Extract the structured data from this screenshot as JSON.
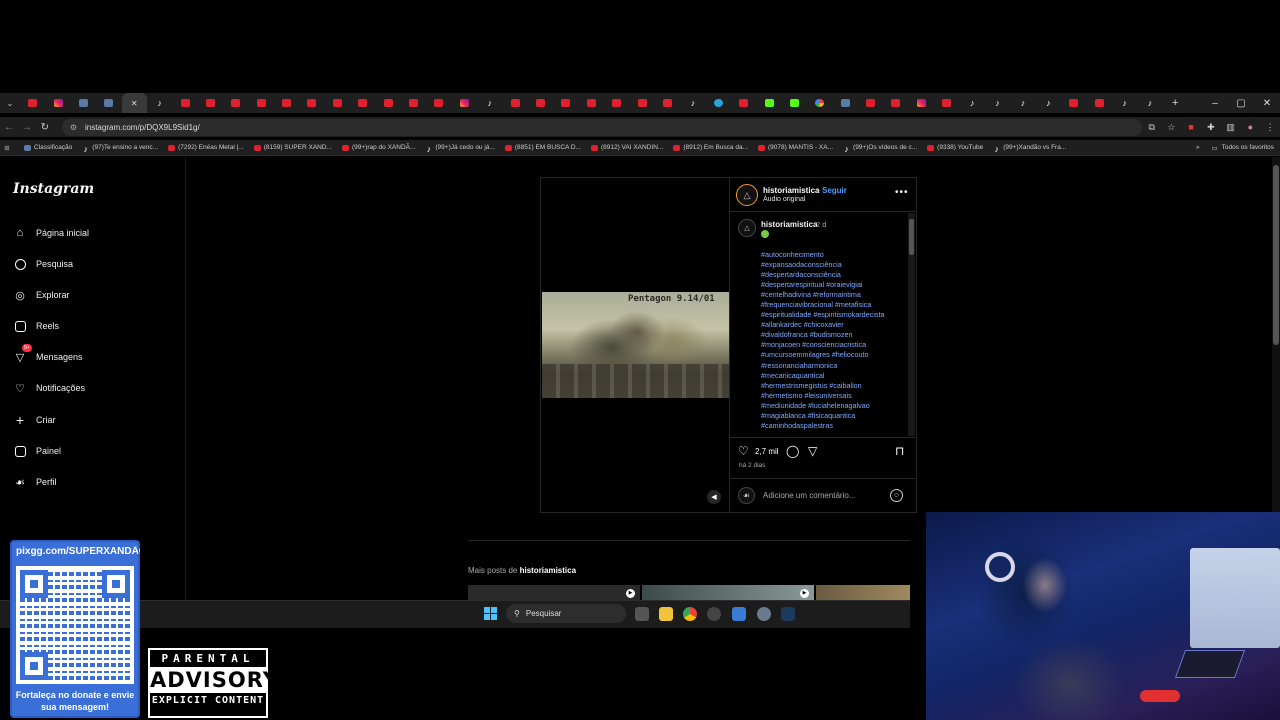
{
  "browser": {
    "tabs": [
      "yt",
      "ig",
      "misc",
      "misc",
      "active",
      "tt",
      "yt",
      "yt",
      "yt",
      "yt",
      "yt",
      "yt",
      "yt",
      "yt",
      "yt",
      "yt",
      "yt",
      "ig",
      "tt",
      "yt",
      "yt",
      "yt",
      "yt",
      "yt",
      "yt",
      "yt",
      "tt",
      "tg",
      "yt",
      "kick",
      "kick",
      "gg",
      "misc",
      "yt",
      "yt",
      "ig",
      "yt",
      "tt",
      "tt",
      "tt",
      "tt",
      "yt",
      "yt",
      "tt",
      "tt"
    ],
    "new_tab": "+",
    "window_controls": [
      "–",
      "▢",
      "✕"
    ],
    "url": "instagram.com/p/DQX9L9Sid1g/",
    "bookmarks": [
      {
        "icon": "misc",
        "label": "Classificação"
      },
      {
        "icon": "tt",
        "label": "(97)Te ensino a venc..."
      },
      {
        "icon": "yt",
        "label": "(7292) Enéas Metal |..."
      },
      {
        "icon": "yt",
        "label": "(8159) SUPER XAND..."
      },
      {
        "icon": "yt",
        "label": "(99+)rap do XANDÃ..."
      },
      {
        "icon": "tt",
        "label": "(99+)Já cedo ou já..."
      },
      {
        "icon": "yt",
        "label": "(8851) EM BUSCA D..."
      },
      {
        "icon": "yt",
        "label": "(8912) VAI XANDIN..."
      },
      {
        "icon": "yt",
        "label": "(8912) Em Busca da..."
      },
      {
        "icon": "yt",
        "label": "(9078) MANTIS - XA..."
      },
      {
        "icon": "tt",
        "label": "(99+)Os vídeos de c..."
      },
      {
        "icon": "yt",
        "label": "(9338) YouTube"
      },
      {
        "icon": "tt",
        "label": "(99+)Xandão vs Fra..."
      }
    ],
    "bookmarks_more": "»",
    "all_bookmarks": "Todos os favoritos"
  },
  "instagram": {
    "logo": "Instagram",
    "nav": [
      {
        "label": "Página inicial",
        "icon": "home-icon"
      },
      {
        "label": "Pesquisa",
        "icon": "search-icon"
      },
      {
        "label": "Explorar",
        "icon": "compass-icon"
      },
      {
        "label": "Reels",
        "icon": "reels-icon"
      },
      {
        "label": "Mensagens",
        "icon": "messenger-icon",
        "badge": "9+"
      },
      {
        "label": "Notificações",
        "icon": "heart-icon"
      },
      {
        "label": "Criar",
        "icon": "plus-icon"
      },
      {
        "label": "Painel",
        "icon": "dashboard-icon"
      },
      {
        "label": "Perfil",
        "icon": "profile-avatar-icon"
      }
    ],
    "post": {
      "video_caption": "Pentagon 9.14/01",
      "username": "historiamistica",
      "separator": "•",
      "follow": "Seguir",
      "audio": "Áudio original",
      "more": "•••",
      "comment_time": "2 d",
      "hashtags": [
        "#autoconhecimento",
        "#expansaodaconsciência",
        "#despertardaconsciência",
        "#despertarespiritual #oraievigiai",
        "#centelhadivina #reformaintima",
        "#frequenciavibracional #metafisica",
        "#espiritualidade #espiritismokardecista",
        "#allankardec #chicoxavier",
        "#divaldofranca #budismozen",
        "#monjacoen #conscienciacristica",
        "#umcursoemmilagres #heliocouto",
        "#ressonanciaharmonica",
        "#mecanicaquantical",
        "#hermestrismegistus #caibalion",
        "#hermetismo #leisuniversais",
        "#mediunidade #luciahelenagalvao",
        "#magiablanca #fisicaquantica",
        "#caminhodaspalestras"
      ],
      "likes": "2,7 mil",
      "posted": "há 2 dias",
      "comment_placeholder": "Adicione um comentário..."
    },
    "more_posts_prefix": "Mais posts de ",
    "more_posts_user": "historiamistica"
  },
  "taskbar": {
    "search": "Pesquisar"
  },
  "overlay": {
    "pix_url": "pixgg.com/SUPERXANDÃO",
    "pix_message": "Fortaleça no donate e envie sua mensagem!",
    "advisory_top": "PARENTAL",
    "advisory_mid": "ADVISORY",
    "advisory_bottom": "EXPLICIT CONTENT"
  }
}
